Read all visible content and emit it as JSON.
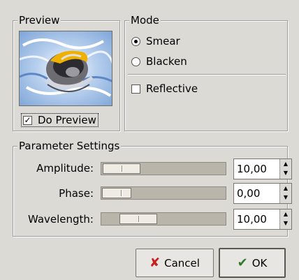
{
  "preview": {
    "title": "Preview",
    "do_preview_label": "Do Preview",
    "do_preview_checked": true
  },
  "mode": {
    "title": "Mode",
    "options": [
      "Smear",
      "Blacken"
    ],
    "selected": "Smear",
    "reflective_label": "Reflective",
    "reflective_checked": false
  },
  "params": {
    "title": "Parameter Settings",
    "rows": [
      {
        "label": "Amplitude:",
        "value": "10,00",
        "slider_fraction": 0.2
      },
      {
        "label": "Phase:",
        "value": "0,00",
        "slider_fraction": 0.14
      },
      {
        "label": "Wavelength:",
        "value": "10,00",
        "slider_fraction": 0.27
      }
    ]
  },
  "buttons": {
    "cancel_label": "Cancel",
    "ok_label": "OK"
  },
  "colors": {
    "background": "#dcdad5",
    "trough": "#bab5ab",
    "preview_blue": "#8fb4e0",
    "preview_yellow": "#f0b000"
  }
}
